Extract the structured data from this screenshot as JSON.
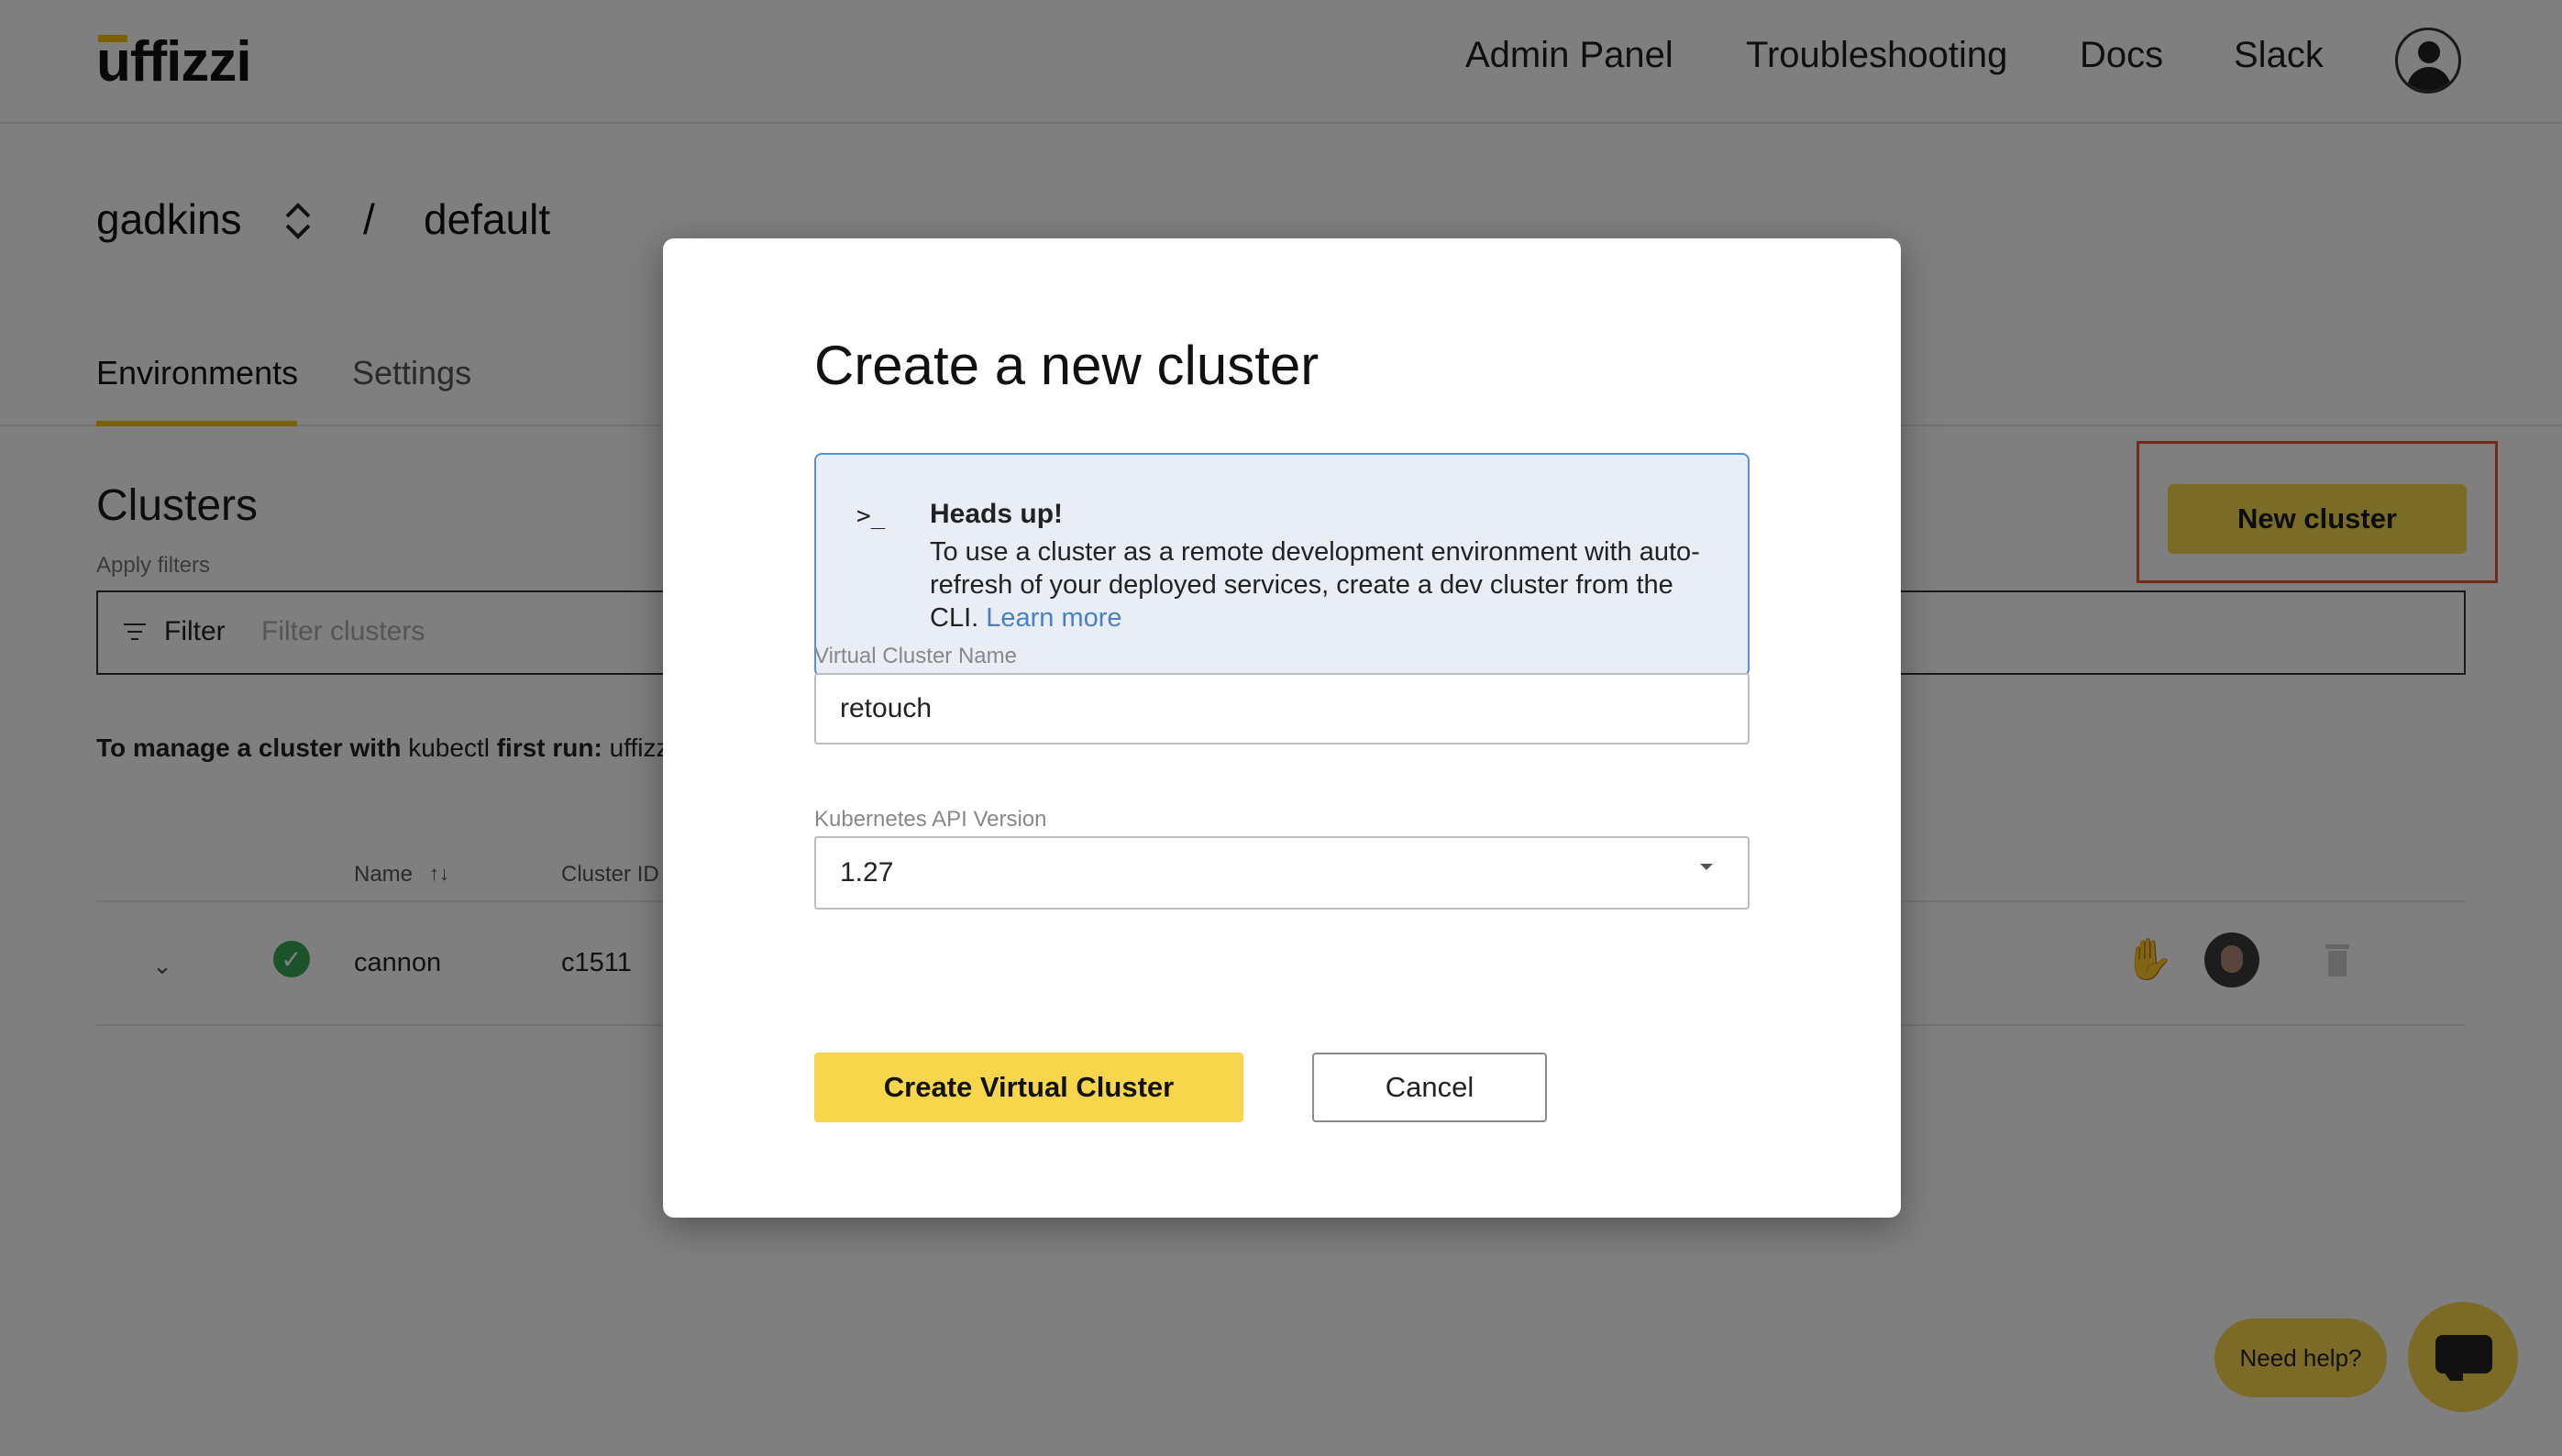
{
  "header": {
    "logo": "uffizzi",
    "nav": [
      "Admin Panel",
      "Troubleshooting",
      "Docs",
      "Slack"
    ]
  },
  "breadcrumb": {
    "account": "gadkins",
    "separator": "/",
    "project": "default"
  },
  "tabs": [
    "Environments",
    "Settings"
  ],
  "clusters": {
    "title": "Clusters",
    "apply_filters": "Apply filters",
    "filter_label": "Filter",
    "filter_placeholder": "Filter clusters",
    "new_cluster_label": "New cluster",
    "manage_prefix": "To manage a cluster with",
    "manage_tool": "kubectl",
    "manage_first_run": "first run:",
    "manage_cmd": "uffizzi",
    "columns": [
      "Name",
      "Cluster ID"
    ],
    "rows": [
      {
        "name": "cannon",
        "id": "c1511",
        "status": "ok"
      }
    ]
  },
  "help": {
    "label": "Need help?"
  },
  "modal": {
    "title": "Create a new cluster",
    "alert": {
      "prompt": ">_",
      "title": "Heads up!",
      "body": "To use a cluster as a remote development environment with auto-refresh of your deployed services, create a dev cluster from the CLI.",
      "link": "Learn more"
    },
    "name_label": "Virtual Cluster Name",
    "name_value": "retouch",
    "version_label": "Kubernetes API Version",
    "version_value": "1.27",
    "create_label": "Create Virtual Cluster",
    "cancel_label": "Cancel"
  },
  "colors": {
    "accent": "#f5d94e",
    "highlight": "#e8523a",
    "link": "#4a7fc4"
  }
}
